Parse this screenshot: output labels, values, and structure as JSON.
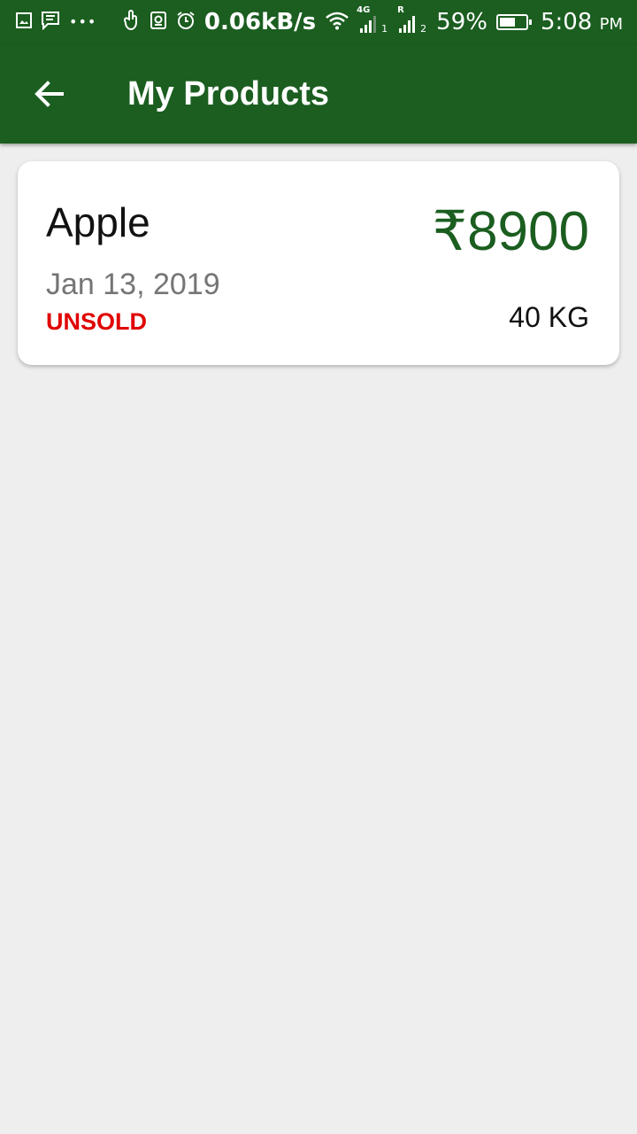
{
  "status_bar": {
    "speed": "0.06kB/s",
    "battery": "59%",
    "battery_level": 0.59,
    "time": "5:08",
    "ampm": "PM",
    "sim1_type": "4G",
    "sim1_index": "1",
    "sim2_type": "R",
    "sim2_index": "2",
    "icons": [
      "image-icon",
      "message-icon",
      "more-dots-icon",
      "touch-icon",
      "storage-icon",
      "alarm-icon",
      "wifi-icon",
      "signal-icon",
      "battery-icon"
    ]
  },
  "appbar": {
    "title": "My Products",
    "back_icon": "arrow-back-icon",
    "color": "#1b5e20"
  },
  "products": [
    {
      "name": "Apple",
      "date": "Jan 13, 2019",
      "status": "UNSOLD",
      "price": "₹8900",
      "quantity": "40 KG",
      "status_color": "#e00000",
      "price_color": "#1b5e20"
    }
  ]
}
